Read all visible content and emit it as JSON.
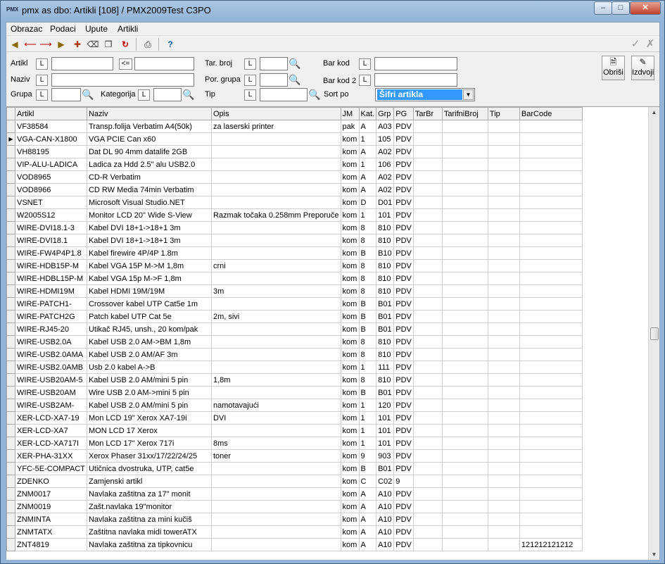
{
  "window": {
    "title": "pmx as dbo: Artikli [108] / PMX2009Test C3PO",
    "app_icon_text": "PMX"
  },
  "menu": [
    "Obrazac",
    "Podaci",
    "Upute",
    "Artikli"
  ],
  "toolbar": {
    "icons": [
      "first-record-icon",
      "previous-record-icon",
      "next-record-icon",
      "last-record-icon",
      "new-record-icon",
      "delete-icon",
      "copy-icon",
      "refresh-icon",
      "print-icon",
      "help-icon"
    ],
    "confirm_icon": "checkmark-icon",
    "cancel_icon": "x-icon"
  },
  "filters": {
    "artikl_label": "Artikl",
    "range_label": "<=",
    "naziv_label": "Naziv",
    "grupa_label": "Grupa",
    "kategorija_label": "Kategorija",
    "tar_broj_label": "Tar. broj",
    "por_grupa_label": "Por. grupa",
    "tip_label": "Tip",
    "bar_kod_label": "Bar kod",
    "bar_kod2_label": "Bar kod 2",
    "sort_label": "Sort po",
    "sort_value": "Šifri artikla",
    "l_button": "L",
    "obrisi_label": "Obriši",
    "izdvoji_label": "Izdvoji"
  },
  "grid": {
    "columns": [
      "Artikl",
      "Naziv",
      "Opis",
      "JM",
      "Kat.",
      "Grp",
      "PG",
      "TarBr",
      "TarifniBroj",
      "Tip",
      "BarCode"
    ],
    "current_row_marker": "▶",
    "rows": [
      [
        "VF38584",
        "Transp.folija Verbatim A4(50k)",
        "za laserski printer",
        "pak",
        "A",
        "A03",
        "PDV",
        "",
        "",
        "",
        ""
      ],
      [
        "VGA-CAN-X1800",
        "VGA PCIE Can x60",
        "",
        "kom",
        "1",
        "105",
        "PDV",
        "",
        "",
        "",
        ""
      ],
      [
        "VH88195",
        "Dat DL 90 4mm datalife 2GB",
        "",
        "kom",
        "A",
        "A02",
        "PDV",
        "",
        "",
        "",
        ""
      ],
      [
        "VIP-ALU-LADICA",
        "Ladica za Hdd 2.5\" alu USB2.0",
        "",
        "kom",
        "1",
        "106",
        "PDV",
        "",
        "",
        "",
        ""
      ],
      [
        "VOD8965",
        "CD-R Verbatim",
        "",
        "kom",
        "A",
        "A02",
        "PDV",
        "",
        "",
        "",
        ""
      ],
      [
        "VOD8966",
        "CD RW Media 74min Verbatim",
        "",
        "kom",
        "A",
        "A02",
        "PDV",
        "",
        "",
        "",
        ""
      ],
      [
        "VSNET",
        "Microsoft Visual Studio.NET",
        "",
        "kom",
        "D",
        "D01",
        "PDV",
        "",
        "",
        "",
        ""
      ],
      [
        "W2005S12",
        "Monitor LCD 20\" Wide S-View",
        "Razmak točaka 0.258mm Preporuče",
        "kom",
        "1",
        "101",
        "PDV",
        "",
        "",
        "",
        ""
      ],
      [
        "WIRE-DVI18.1-3",
        "Kabel DVI 18+1->18+1 3m",
        "",
        "kom",
        "8",
        "810",
        "PDV",
        "",
        "",
        "",
        ""
      ],
      [
        "WIRE-DVI18.1",
        "Kabel DVI 18+1->18+1 3m",
        "",
        "kom",
        "8",
        "810",
        "PDV",
        "",
        "",
        "",
        ""
      ],
      [
        "WIRE-FW4P4P1.8",
        "Kabel firewire 4P/4P 1.8m",
        "",
        "kom",
        "B",
        "B10",
        "PDV",
        "",
        "",
        "",
        ""
      ],
      [
        "WIRE-HDB15P-M",
        "Kabel VGA 15P M->M 1,8m",
        "crni",
        "kom",
        "8",
        "810",
        "PDV",
        "",
        "",
        "",
        ""
      ],
      [
        "WIRE-HDBL15P-M",
        "Kabel VGA 15p M->F 1,8m",
        "",
        "kom",
        "8",
        "810",
        "PDV",
        "",
        "",
        "",
        ""
      ],
      [
        "WIRE-HDMI19M",
        "Kabel HDMI 19M/19M",
        "3m",
        "kom",
        "8",
        "810",
        "PDV",
        "",
        "",
        "",
        ""
      ],
      [
        "WIRE-PATCH1-",
        "Crossover kabel UTP Cat5e 1m",
        "",
        "kom",
        "B",
        "B01",
        "PDV",
        "",
        "",
        "",
        ""
      ],
      [
        "WIRE-PATCH2G",
        "Patch kabel UTP Cat 5e",
        "2m, sivi",
        "kom",
        "B",
        "B01",
        "PDV",
        "",
        "",
        "",
        ""
      ],
      [
        "WIRE-RJ45-20",
        "Utikač RJ45, unsh., 20 kom/pak",
        "",
        "kom",
        "B",
        "B01",
        "PDV",
        "",
        "",
        "",
        ""
      ],
      [
        "WIRE-USB2.0A",
        "Kabel USB 2.0 AM->BM 1,8m",
        "",
        "kom",
        "8",
        "810",
        "PDV",
        "",
        "",
        "",
        ""
      ],
      [
        "WIRE-USB2.0AMA",
        "Kabel USB 2.0 AM/AF 3m",
        "",
        "kom",
        "8",
        "810",
        "PDV",
        "",
        "",
        "",
        ""
      ],
      [
        "WIRE-USB2.0AMB",
        "Usb 2.0  kabel A->B",
        "",
        "kom",
        "1",
        "111",
        "PDV",
        "",
        "",
        "",
        ""
      ],
      [
        "WIRE-USB20AM-5",
        "Kabel USB 2.0 AM/mini 5 pin",
        "1,8m",
        "kom",
        "8",
        "810",
        "PDV",
        "",
        "",
        "",
        ""
      ],
      [
        "WIRE-USB20AM",
        "Wire USB 2.0 AM->mini 5 pin",
        "",
        "kom",
        "B",
        "B01",
        "PDV",
        "",
        "",
        "",
        ""
      ],
      [
        "WIRE-USB2AM-",
        "Kabel USB 2.0 AM/mini 5 pin",
        "namotavajući",
        "kom",
        "1",
        "120",
        "PDV",
        "",
        "",
        "",
        ""
      ],
      [
        "XER-LCD-XA7-19",
        "Mon LCD 19\" Xerox XA7-19i",
        "DVI",
        "kom",
        "1",
        "101",
        "PDV",
        "",
        "",
        "",
        ""
      ],
      [
        "XER-LCD-XA7",
        "MON LCD 17 Xerox",
        "",
        "kom",
        "1",
        "101",
        "PDV",
        "",
        "",
        "",
        ""
      ],
      [
        "XER-LCD-XA717I",
        "Mon LCD 17\" Xerox 717i",
        "8ms",
        "kom",
        "1",
        "101",
        "PDV",
        "",
        "",
        "",
        ""
      ],
      [
        "XER-PHA-31XX",
        "Xerox Phaser 31xx/17/22/24/25",
        "toner",
        "kom",
        "9",
        "903",
        "PDV",
        "",
        "",
        "",
        ""
      ],
      [
        "YFC-5E-COMPACT",
        "Utičnica dvostruka, UTP, cat5e",
        "",
        "kom",
        "B",
        "B01",
        "PDV",
        "",
        "",
        "",
        ""
      ],
      [
        "ZDENKO",
        "Zamjenski artikl",
        "",
        "kom",
        "C",
        "C02",
        "9",
        "",
        "",
        "",
        ""
      ],
      [
        "ZNM0017",
        "Navlaka zaštitna za  17\" monit",
        "",
        "kom",
        "A",
        "A10",
        "PDV",
        "",
        "",
        "",
        ""
      ],
      [
        "ZNM0019",
        "Zašt.navlaka 19\"monitor",
        "",
        "kom",
        "A",
        "A10",
        "PDV",
        "",
        "",
        "",
        ""
      ],
      [
        "ZNMINTA",
        "Navlaka zaštitna za mini kučiš",
        "",
        "kom",
        "A",
        "A10",
        "PDV",
        "",
        "",
        "",
        ""
      ],
      [
        "ZNMTATX",
        "Zaštitna navlaka midi towerATX",
        "",
        "kom",
        "A",
        "A10",
        "PDV",
        "",
        "",
        "",
        ""
      ],
      [
        "ZNT4819",
        "Navlaka zaštitna za tipkovnicu",
        "",
        "kom",
        "A",
        "A10",
        "PDV",
        "",
        "",
        "",
        "121212121212"
      ]
    ]
  },
  "colors": {
    "selection": "#3399ff",
    "window_frame": "#93b4d6"
  }
}
